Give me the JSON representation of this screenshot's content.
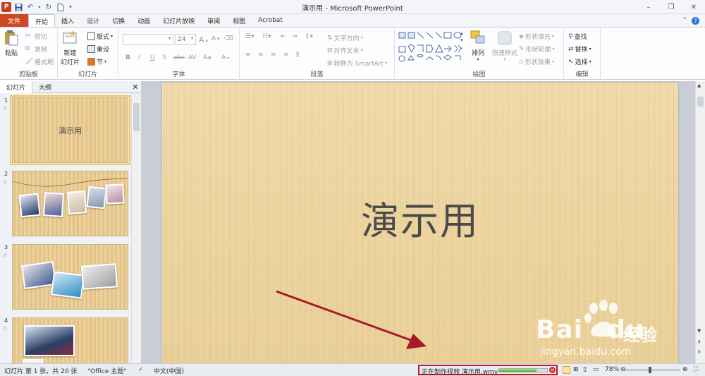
{
  "window": {
    "title": "演示用 - Microsoft PowerPoint",
    "controls": [
      "–",
      "❐",
      "✕"
    ]
  },
  "tabs": [
    {
      "label": "文件"
    },
    {
      "label": "开始"
    },
    {
      "label": "插入"
    },
    {
      "label": "设计"
    },
    {
      "label": "切换"
    },
    {
      "label": "动画"
    },
    {
      "label": "幻灯片放映"
    },
    {
      "label": "审阅"
    },
    {
      "label": "视图"
    },
    {
      "label": "Acrobat"
    }
  ],
  "ribbon": {
    "clipboard": {
      "label": "剪贴板",
      "paste": "粘贴",
      "cut": "剪切",
      "copy": "复制",
      "format_painter": "格式刷"
    },
    "slides": {
      "label": "幻灯片",
      "new_slide": "新建",
      "new_slide2": "幻灯片",
      "layout": "版式",
      "reset": "重设",
      "section": "节"
    },
    "font": {
      "label": "字体",
      "font_size": "24",
      "b": "B",
      "i": "I",
      "u": "U",
      "s": "S",
      "abc": "abc",
      "av": "AV",
      "aa": "Aa",
      "a": "A",
      "grow": "A",
      "shrink": "A"
    },
    "paragraph": {
      "label": "段落",
      "text_direction": "文字方向",
      "align_text": "对齐文本",
      "smartart": "转换为 SmartArt"
    },
    "drawing": {
      "label": "绘图",
      "arrange": "排列",
      "quick_styles": "快速样式",
      "shape_fill": "形状填充",
      "shape_outline": "形状轮廓",
      "shape_effects": "形状效果"
    },
    "editing": {
      "label": "编辑",
      "find": "查找",
      "replace": "替换",
      "select": "选择"
    }
  },
  "left_panel": {
    "tabs": [
      "幻灯片",
      "大纲"
    ],
    "close": "✕",
    "slides": [
      {
        "num": "1",
        "title": "演示用"
      },
      {
        "num": "2"
      },
      {
        "num": "3"
      },
      {
        "num": "4"
      }
    ]
  },
  "slide": {
    "title": "演示用"
  },
  "watermark": {
    "brand": "Bai",
    "brand2": "du",
    "cn": "经验",
    "url": "jingyan.baidu.com"
  },
  "status": {
    "slide_info": "幻灯片 第 1 张，共 20 张",
    "theme": "\"Office 主题\"",
    "language": "中文(中国)",
    "progress_label": "正在制作视频 演示用.wmv",
    "progress": 0.78,
    "zoom": "78%"
  },
  "colors": {
    "file_tab": "#d24726",
    "highlight_box": "#c0182a",
    "arrow": "#a8182a",
    "progress": "#52b52e"
  }
}
